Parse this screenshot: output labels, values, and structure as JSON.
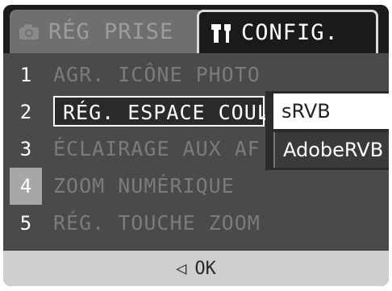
{
  "tabs": [
    {
      "label": "RÉG PRISE",
      "icon": "camera-icon",
      "active": false
    },
    {
      "label": "CONFIG.",
      "icon": "settings-tools-icon",
      "active": true
    }
  ],
  "menu": {
    "items": [
      {
        "num": "1",
        "label": "AGR. ICÔNE PHOTO"
      },
      {
        "num": "2",
        "label": "RÉG. ESPACE COUL"
      },
      {
        "num": "3",
        "label": "ÉCLAIRAGE AUX AF"
      },
      {
        "num": "4",
        "label": "ZOOM NUMÉRIQUE"
      },
      {
        "num": "5",
        "label": "RÉG. TOUCHE ZOOM"
      }
    ],
    "selected_page": "4"
  },
  "submenu": {
    "options": [
      "sRVB",
      "AdobeRVB"
    ],
    "selected": "sRVB"
  },
  "footer": {
    "label": "OK",
    "icon": "left-arrow-icon"
  }
}
